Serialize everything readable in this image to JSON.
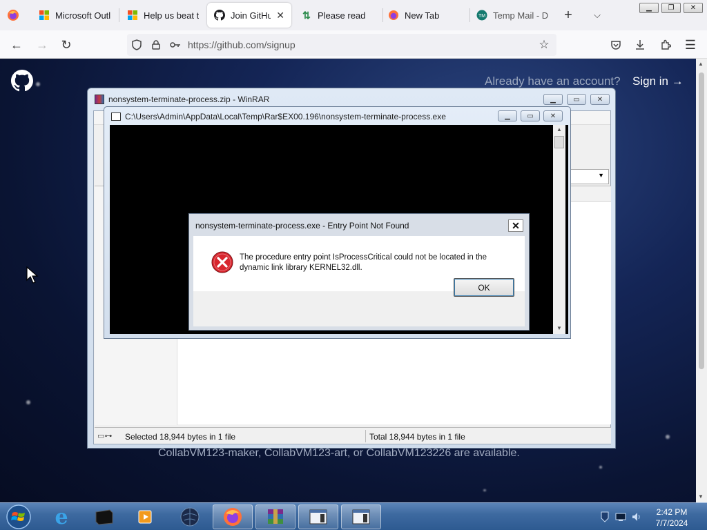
{
  "browser": {
    "tabs": [
      {
        "label": "Microsoft Outlo",
        "icon": "microsoft-icon"
      },
      {
        "label": "Help us beat th",
        "icon": "microsoft-icon"
      },
      {
        "label": "Join GitHub",
        "icon": "github-icon",
        "active": true
      },
      {
        "label": "Please read",
        "icon": "sort-arrows-icon"
      },
      {
        "label": "New Tab",
        "icon": "firefox-icon"
      },
      {
        "label": "Temp Mail - Di",
        "icon": "tempmail-icon"
      }
    ],
    "url": "https://github.com/signup"
  },
  "page": {
    "have_account": "Already have an account?",
    "sign_in": "Sign in →",
    "bottom_text": "CollabVM123-maker, CollabVM123-art, or CollabVM123226 are available."
  },
  "winrar": {
    "title": "nonsystem-terminate-process.zip - WinRAR",
    "status_left": "Selected 18,944 bytes in 1 file",
    "status_right": "Total 18,944 bytes in 1 file"
  },
  "console": {
    "title": "C:\\Users\\Admin\\AppData\\Local\\Temp\\Rar$EX00.196\\nonsystem-terminate-process.exe"
  },
  "dialog": {
    "title": "nonsystem-terminate-process.exe - Entry Point Not Found",
    "message": "The procedure entry point IsProcessCritical could not be located in the dynamic link library KERNEL32.dll.",
    "ok_label": "OK"
  },
  "taskbar": {
    "time": "2:42 PM",
    "date": "7/7/2024"
  },
  "colors": {
    "error_red": "#d8262e",
    "taskbar_blue": "#3e6aa0",
    "page_bg": "#142556"
  }
}
